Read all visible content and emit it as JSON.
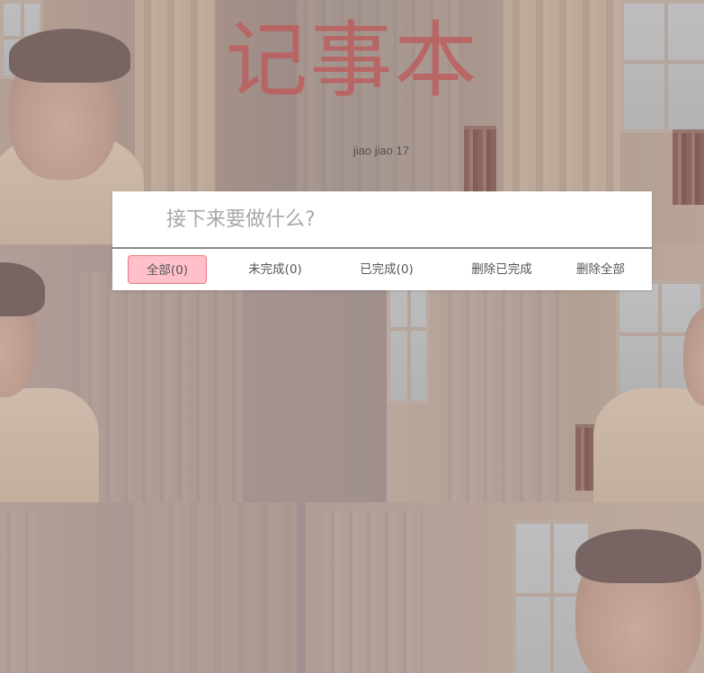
{
  "header": {
    "title": "记事本",
    "subtitle": "jiao jiao 17"
  },
  "input": {
    "placeholder": "接下来要做什么?",
    "value": ""
  },
  "filters": [
    {
      "label": "全部(0)",
      "active": true
    },
    {
      "label": "未完成(0)",
      "active": false
    },
    {
      "label": "已完成(0)",
      "active": false
    },
    {
      "label": "删除已完成",
      "active": false
    },
    {
      "label": "删除全部",
      "active": false
    }
  ],
  "colors": {
    "title": "#c0605e",
    "active_filter_bg": "#ffc0cb",
    "active_filter_border": "#e9787e"
  }
}
